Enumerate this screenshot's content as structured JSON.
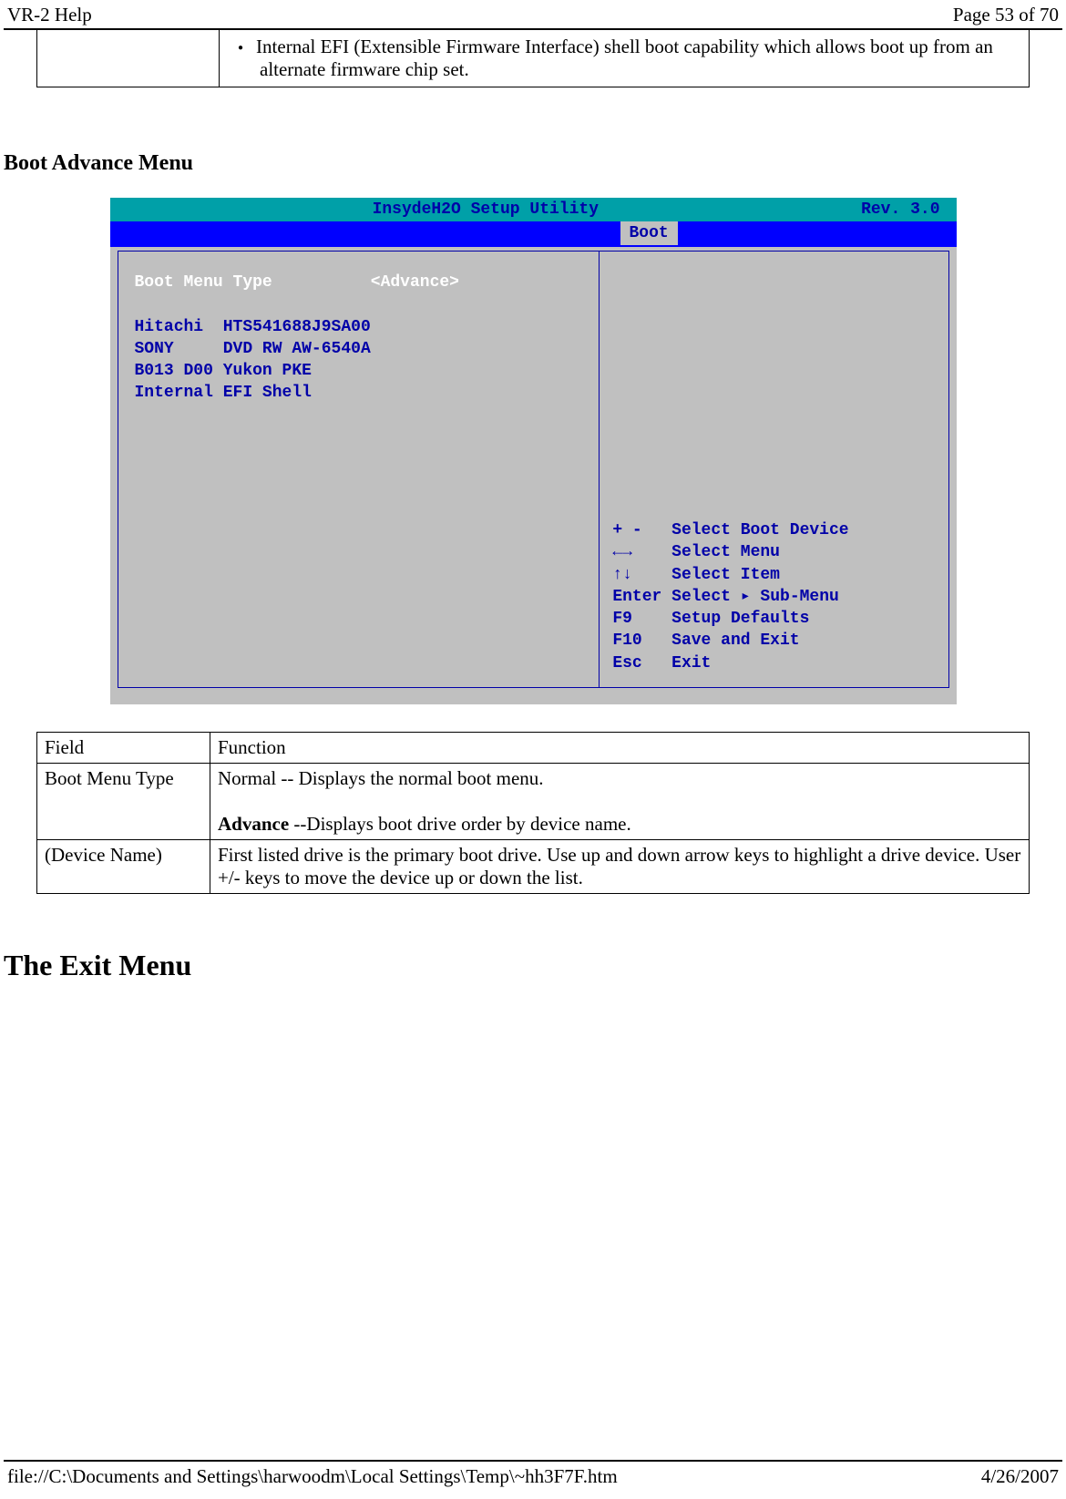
{
  "header": {
    "left": "VR-2 Help",
    "right": "Page 53 of 70"
  },
  "top_row_bullet": "Internal  EFI (Extensible Firmware Interface) shell boot capability which allows boot up from an  alternate firmware chip set.",
  "section_heading": "Boot Advance Menu",
  "bios": {
    "title_center": "InsydeH2O Setup Utility",
    "title_right": "Rev. 3.0",
    "tab_active": "Boot",
    "menu_type_label": "Boot Menu Type",
    "menu_type_value": "<Advance>",
    "devices": [
      "Hitachi  HTS541688J9SA00",
      "SONY     DVD RW AW-6540A",
      "B013 D00 Yukon PKE",
      "Internal EFI Shell"
    ],
    "help": [
      {
        "k": "+ -",
        "v": "Select Boot Device"
      },
      {
        "k": "←→",
        "v": "Select Menu"
      },
      {
        "k": "↑↓",
        "v": "Select Item"
      },
      {
        "k": "Enter",
        "v": "Select ▸ Sub-Menu"
      },
      {
        "k": "F9",
        "v": "Setup Defaults"
      },
      {
        "k": "F10",
        "v": "Save and Exit"
      },
      {
        "k": "Esc",
        "v": "Exit"
      }
    ]
  },
  "def_table": {
    "h1": "Field",
    "h2": "Function",
    "rows": [
      {
        "field": "Boot Menu Type",
        "func_line1": "Normal -- Displays the normal boot menu.",
        "func_bold": "Advance ",
        "func_line2": "--Displays boot drive order by device name."
      },
      {
        "field": "(Device Name)",
        "func_line1": " First listed drive is the primary boot drive.  Use up and down arrow keys to highlight a drive device.  User +/- keys to move the device up or down the list."
      }
    ]
  },
  "exit_heading": "The Exit Menu",
  "footer": {
    "left": "file://C:\\Documents and Settings\\harwoodm\\Local Settings\\Temp\\~hh3F7F.htm",
    "right": "4/26/2007"
  }
}
